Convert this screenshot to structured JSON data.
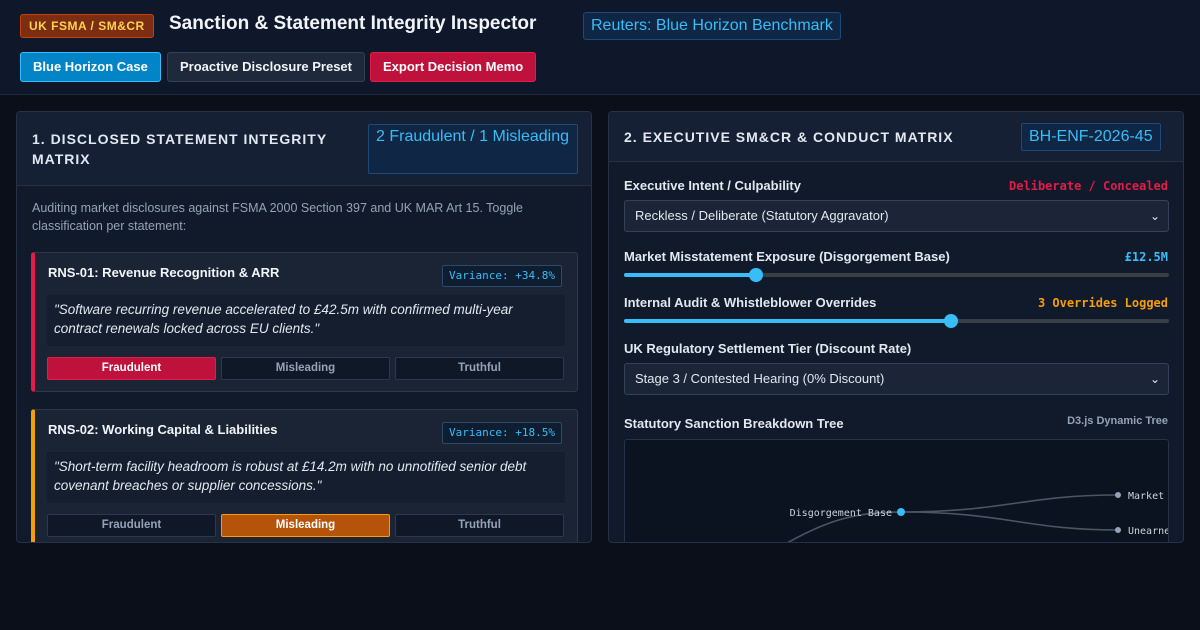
{
  "header": {
    "tag": "UK FSMA / SM&CR",
    "title": "Sanction & Statement Integrity Inspector",
    "reference": "Reuters: Blue Horizon Benchmark",
    "buttons": {
      "case": "Blue Horizon Case",
      "preset": "Proactive Disclosure Preset",
      "export": "Export Decision Memo"
    }
  },
  "left_panel": {
    "title": "1. DISCLOSED STATEMENT INTEGRITY MATRIX",
    "badge": "2 Fraudulent / 1 Misleading",
    "intro": "Auditing market disclosures against FSMA 2000 Section 397 and UK MAR Art 15. Toggle classification per statement:",
    "statements": [
      {
        "title": "RNS-01: Revenue Recognition & ARR",
        "variance": "Variance: +34.8%",
        "quote": "\"Software recurring revenue accelerated to £42.5m with confirmed multi-year contract renewals locked across EU clients.\"",
        "options": [
          "Fraudulent",
          "Misleading",
          "Truthful"
        ],
        "selected": "Fraudulent"
      },
      {
        "title": "RNS-02: Working Capital & Liabilities",
        "variance": "Variance: +18.5%",
        "quote": "\"Short-term facility headroom is robust at £14.2m with no unnotified senior debt covenant breaches or supplier concessions.\"",
        "options": [
          "Fraudulent",
          "Misleading",
          "Truthful"
        ],
        "selected": "Misleading"
      }
    ]
  },
  "right_panel": {
    "title": "2. EXECUTIVE SM&CR & CONDUCT MATRIX",
    "badge": "BH-ENF-2026-45",
    "intent": {
      "label": "Executive Intent / Culpability",
      "value": "Deliberate / Concealed",
      "selected": "Reckless / Deliberate (Statutory Aggravator)"
    },
    "exposure": {
      "label": "Market Misstatement Exposure (Disgorgement Base)",
      "value": "£12.5M",
      "level": 0.243
    },
    "overrides": {
      "label": "Internal Audit & Whistleblower Overrides",
      "value": "3 Overrides Logged",
      "level": 0.6
    },
    "settlement": {
      "label": "UK Regulatory Settlement Tier (Discount Rate)",
      "selected": "Stage 3 / Contested Hearing (0% Discount)"
    },
    "tree": {
      "label": "Statutory Sanction Breakdown Tree",
      "tag": "D3.js Dynamic Tree",
      "root": "Disgorgement Base",
      "children": [
        "Market Val",
        "Unearned I"
      ]
    }
  }
}
